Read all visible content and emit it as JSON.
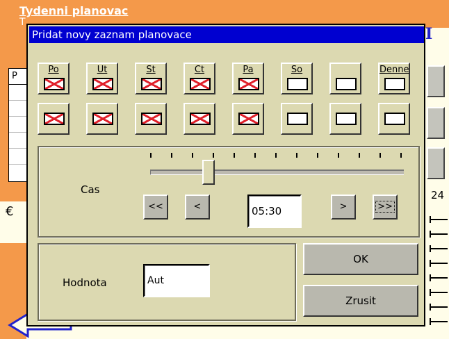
{
  "background": {
    "title": "Tydenni planovac",
    "title_line2": "T",
    "table_header": "P",
    "corner_glyph": "I",
    "scale_label": "24",
    "left_glyph": "€"
  },
  "dialog": {
    "title": "Pridat novy zaznam planovace",
    "days": [
      {
        "label": "Po",
        "row1_checked": true,
        "row2_checked": true
      },
      {
        "label": "Ut",
        "row1_checked": true,
        "row2_checked": true
      },
      {
        "label": "St",
        "row1_checked": true,
        "row2_checked": true
      },
      {
        "label": "Ct",
        "row1_checked": true,
        "row2_checked": true
      },
      {
        "label": "Pa",
        "row1_checked": true,
        "row2_checked": true
      },
      {
        "label": "So",
        "row1_checked": false,
        "row2_checked": false
      },
      {
        "label": "",
        "row1_checked": false,
        "row2_checked": false
      },
      {
        "label": "Denne",
        "row1_checked": false,
        "row2_checked": false
      }
    ],
    "time": {
      "label": "Cas",
      "value": "05:30",
      "slider_fraction": 0.23,
      "btn_fast_back": "<<",
      "btn_back": "<",
      "btn_forward": ">",
      "btn_fast_forward": ">>"
    },
    "value": {
      "label": "Hodnota",
      "input_value": "Aut"
    },
    "ok_label": "OK",
    "cancel_label": "Zrusit"
  },
  "colors": {
    "title_bar": "#0000d0",
    "dialog_bg": "#dcd9b1",
    "bg_title": "#f4994a",
    "cross": "#e0202a"
  }
}
